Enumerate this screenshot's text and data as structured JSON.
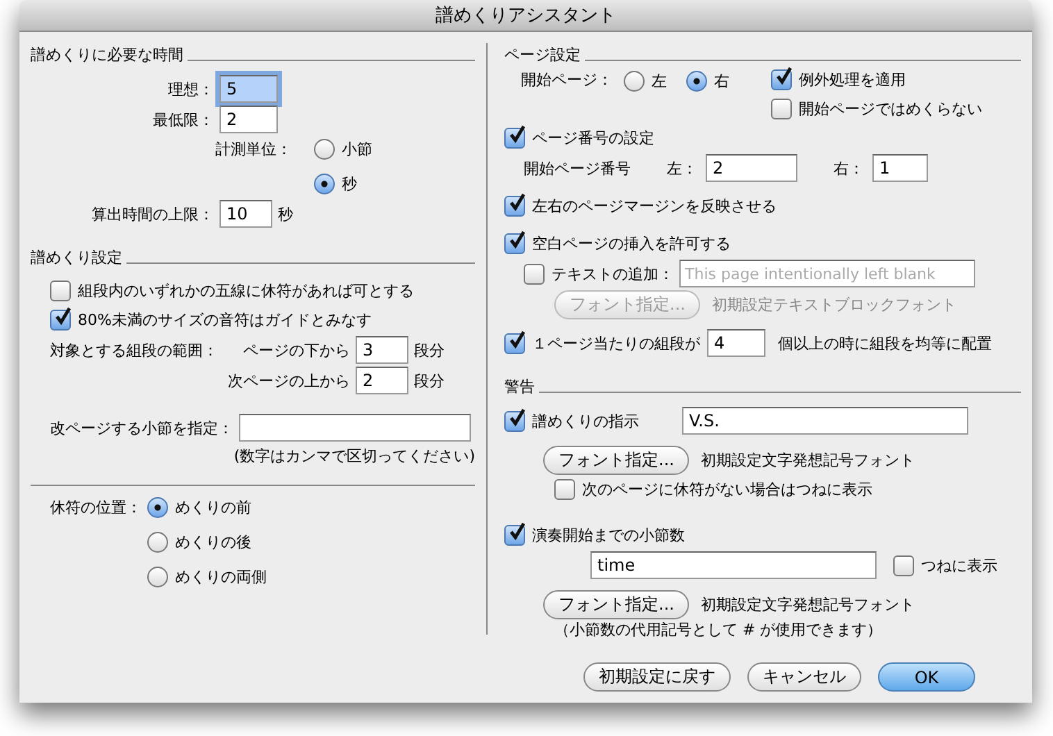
{
  "window": {
    "title": "譜めくりアシスタント"
  },
  "time_section": {
    "title": "譜めくりに必要な時間",
    "ideal": {
      "label": "理想：",
      "value": "5",
      "focused": true
    },
    "minimum": {
      "label": "最低限：",
      "value": "2",
      "focused": false
    },
    "unit": {
      "label": "計測単位：",
      "options": [
        {
          "label": "小節",
          "selected": false
        },
        {
          "label": "秒",
          "selected": true
        }
      ]
    },
    "upper_limit": {
      "label": "算出時間の上限：",
      "value": "10",
      "unit": "秒"
    }
  },
  "turn_section": {
    "title": "譜めくり設定",
    "checks": [
      {
        "label": "組段内のいずれかの五線に休符があれば可とする",
        "checked": false
      },
      {
        "label": "80%未満のサイズの音符はガイドとみなす",
        "checked": true
      }
    ],
    "range": {
      "label": "対象とする組段の範囲：",
      "rows": [
        {
          "label": "ページの下から",
          "value": "3",
          "unit": "段分"
        },
        {
          "label": "次ページの上から",
          "value": "2",
          "unit": "段分"
        }
      ]
    },
    "page_break_measures": {
      "label": "改ページする小節を指定：",
      "note": "(数字はカンマで区切ってください)"
    }
  },
  "rest_position": {
    "label": "休符の位置：",
    "options": [
      {
        "label": "めくりの前",
        "selected": true
      },
      {
        "label": "めくりの後",
        "selected": false
      },
      {
        "label": "めくりの両側",
        "selected": false
      }
    ]
  },
  "page_section": {
    "title": "ページ設定",
    "start_page": {
      "label": "開始ページ：",
      "options": [
        {
          "label": "左",
          "selected": false
        },
        {
          "label": "右",
          "selected": true
        }
      ]
    },
    "exceptions": [
      {
        "label": "例外処理を適用",
        "checked": true
      },
      {
        "label": "開始ページではめくらない",
        "checked": false
      }
    ],
    "page_numbers": {
      "label": "ページ番号の設定",
      "checked": true,
      "sublabel": "開始ページ番号",
      "left": {
        "label": "左：",
        "value": "2"
      },
      "right": {
        "label": "右：",
        "value": "1"
      }
    },
    "reflect_margins": {
      "label": "左右のページマージンを反映させる",
      "checked": true
    },
    "blank_pages": {
      "label": "空白ページの挿入を許可する",
      "checked": true,
      "add_text": {
        "label": "テキストの追加：",
        "checked": false,
        "placeholder": "This page intentionally left blank"
      },
      "font_button": {
        "label": "フォント指定...",
        "disabled": true
      },
      "font_name": "初期設定テキストブロックフォント"
    },
    "distribute": {
      "label_before": "１ページ当たりの組段が",
      "checked": true,
      "value": "4",
      "label_after": "個以上の時に組段を均等に配置"
    }
  },
  "warnings": {
    "title": "警告",
    "turn_instruction": {
      "label": "譜めくりの指示",
      "checked": true,
      "value": "V.S.",
      "font_button": {
        "label": "フォント指定...",
        "disabled": false
      },
      "font_name": "初期設定文字発想記号フォント",
      "always": {
        "label": "次のページに休符がない場合はつねに表示",
        "checked": false
      }
    },
    "measures_until_start": {
      "label": "演奏開始までの小節数",
      "checked": true,
      "value": "time",
      "always": {
        "label": "つねに表示",
        "checked": false
      },
      "font_button": {
        "label": "フォント指定...",
        "disabled": false
      },
      "font_name": "初期設定文字発想記号フォント",
      "note": "（小節数の代用記号として # が使用できます）"
    }
  },
  "buttons": [
    {
      "label": "初期設定に戻す",
      "kind": "normal"
    },
    {
      "label": "キャンセル",
      "kind": "normal"
    },
    {
      "label": "OK",
      "kind": "default"
    }
  ]
}
